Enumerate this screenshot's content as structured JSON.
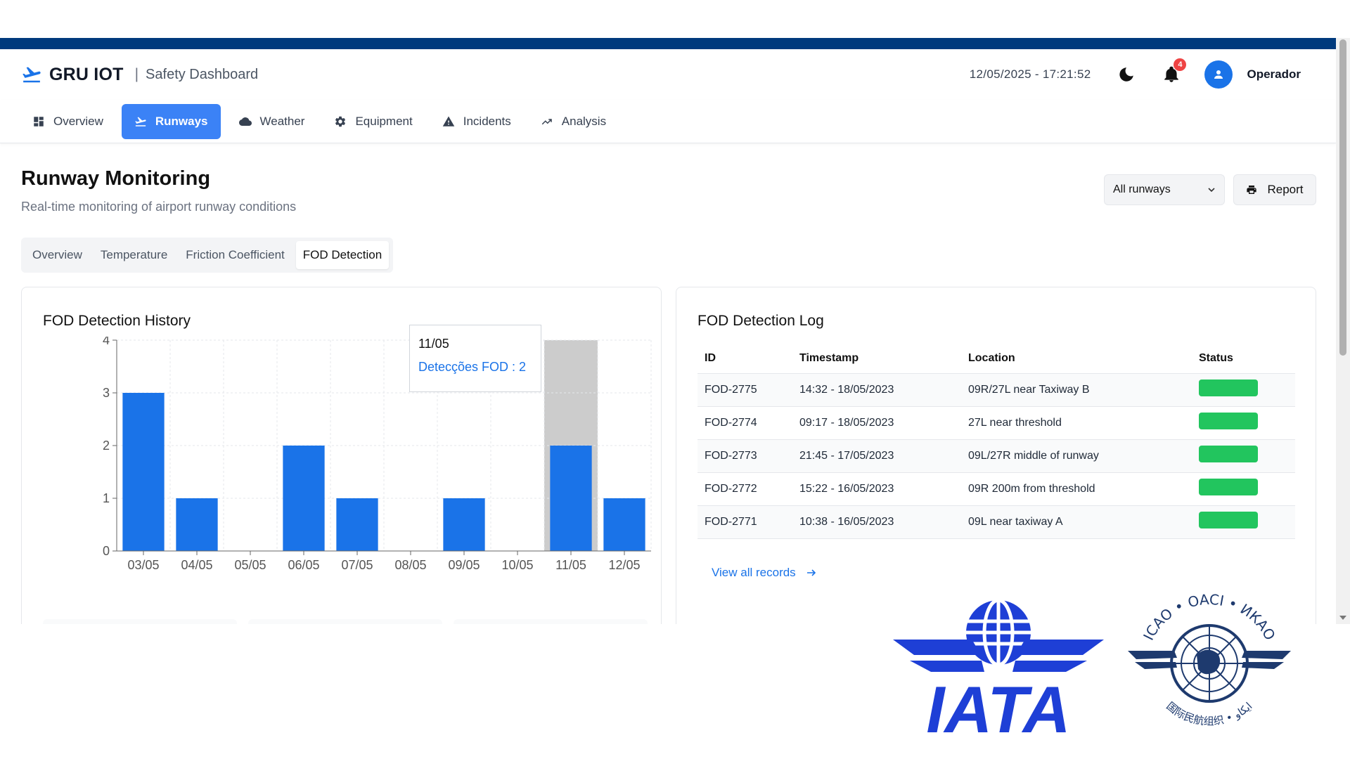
{
  "header": {
    "brand": "GRU IOT",
    "separator": "|",
    "subtitle": "Safety Dashboard",
    "clock": "12/05/2025 - 17:21:52",
    "notification_count": "4",
    "user": "Operador"
  },
  "nav": {
    "items": [
      {
        "label": "Overview",
        "icon": "grid-icon"
      },
      {
        "label": "Runways",
        "icon": "plane-departure-icon",
        "active": true
      },
      {
        "label": "Weather",
        "icon": "cloud-icon"
      },
      {
        "label": "Equipment",
        "icon": "gear-icon"
      },
      {
        "label": "Incidents",
        "icon": "warning-icon"
      },
      {
        "label": "Analysis",
        "icon": "trend-icon"
      }
    ]
  },
  "page": {
    "title": "Runway Monitoring",
    "subtitle": "Real-time monitoring of airport runway conditions",
    "runway_select": "All runways",
    "report_label": "Report"
  },
  "subtabs": [
    "Overview",
    "Temperature",
    "Friction Coefficient",
    "FOD Detection"
  ],
  "history": {
    "title": "FOD Detection History",
    "tooltip_date": "11/05",
    "tooltip_value": "Detecções FOD : 2"
  },
  "chart_data": {
    "type": "bar",
    "title": "FOD Detection History",
    "categories": [
      "03/05",
      "04/05",
      "05/05",
      "06/05",
      "07/05",
      "08/05",
      "09/05",
      "10/05",
      "11/05",
      "12/05"
    ],
    "series": [
      {
        "name": "Detecções FOD",
        "values": [
          3,
          1,
          0,
          2,
          1,
          0,
          1,
          0,
          2,
          1
        ]
      }
    ],
    "ylim": [
      0,
      4
    ],
    "yticks": [
      0,
      1,
      2,
      3,
      4
    ],
    "grid": true,
    "highlight_category": "11/05",
    "bar_color": "#1a73e8",
    "highlight_color": "#cccccc"
  },
  "log": {
    "title": "FOD Detection Log",
    "columns": [
      "ID",
      "Timestamp",
      "Location",
      "Status"
    ],
    "rows": [
      {
        "id": "FOD-2775",
        "timestamp": "14:32 - 18/05/2023",
        "location": "09R/27L near Taxiway B"
      },
      {
        "id": "FOD-2774",
        "timestamp": "09:17 - 18/05/2023",
        "location": "27L near threshold"
      },
      {
        "id": "FOD-2773",
        "timestamp": "21:45 - 17/05/2023",
        "location": "09L/27R middle of runway"
      },
      {
        "id": "FOD-2772",
        "timestamp": "15:22 - 16/05/2023",
        "location": "09R 200m from threshold"
      },
      {
        "id": "FOD-2771",
        "timestamp": "10:38 - 16/05/2023",
        "location": "09L near taxiway A"
      }
    ],
    "status_color": "#22c55e",
    "view_all": "View all records"
  },
  "logos": {
    "iata": "IATA",
    "icao_ring": "ICAO • OACI • ИКАО",
    "icao_bottom": "国际民航组织 • ايكاو"
  },
  "colors": {
    "brand_strip": "#003a7d",
    "accent": "#3b82f6",
    "iata_blue": "#1e3fd6",
    "icao_navy": "#1e3a6e"
  }
}
